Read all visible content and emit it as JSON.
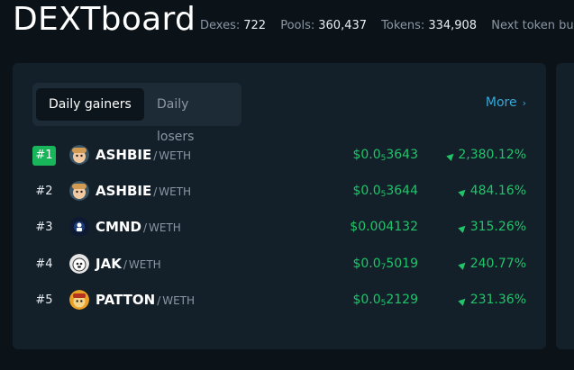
{
  "header": {
    "brand": "DEXTboard",
    "stats": [
      {
        "label": "Dexes:",
        "value": "722"
      },
      {
        "label": "Pools:",
        "value": "360,437"
      },
      {
        "label": "Tokens:",
        "value": "334,908"
      },
      {
        "label": "Next token burn:",
        "value": ""
      }
    ]
  },
  "gainers_panel": {
    "tabs": [
      "Daily gainers",
      "Daily losers"
    ],
    "active_tab": "Daily gainers",
    "more_label": "More",
    "rows": [
      {
        "rank": "#1",
        "symbol": "ASHBIE",
        "quote": "WETH",
        "price_prefix": "$0.0",
        "price_zeros": "5",
        "price_digits": "3643",
        "change": "2,380.12%",
        "avatar_icon": "ashbie-avatar-icon"
      },
      {
        "rank": "#2",
        "symbol": "ASHBIE",
        "quote": "WETH",
        "price_prefix": "$0.0",
        "price_zeros": "5",
        "price_digits": "3644",
        "change": "484.16%",
        "avatar_icon": "ashbie-avatar-icon"
      },
      {
        "rank": "#3",
        "symbol": "CMND",
        "quote": "WETH",
        "price_prefix": "$0.004132",
        "price_zeros": "",
        "price_digits": "",
        "change": "315.26%",
        "avatar_icon": "cmnd-avatar-icon"
      },
      {
        "rank": "#4",
        "symbol": "JAK",
        "quote": "WETH",
        "price_prefix": "$0.0",
        "price_zeros": "7",
        "price_digits": "5019",
        "change": "240.77%",
        "avatar_icon": "jak-avatar-icon"
      },
      {
        "rank": "#5",
        "symbol": "PATTON",
        "quote": "WETH",
        "price_prefix": "$0.0",
        "price_zeros": "5",
        "price_digits": "2129",
        "change": "231.36%",
        "avatar_icon": "patton-avatar-icon"
      }
    ]
  },
  "colors": {
    "background": "#0b1218",
    "card": "#131f29",
    "accent_green": "#20c56a",
    "rank_badge": "#19b55a",
    "link_blue": "#35a9d9",
    "muted_text": "#8b97a3"
  }
}
